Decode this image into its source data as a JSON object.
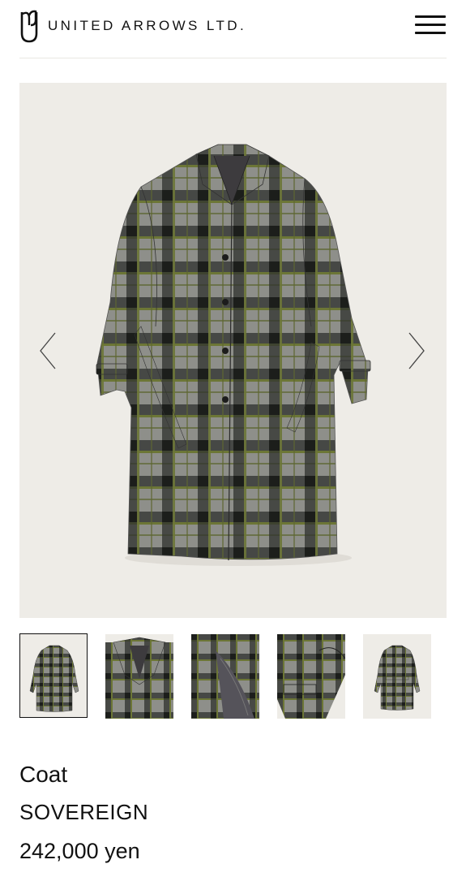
{
  "header": {
    "brand": "UNITED ARROWS LTD.",
    "logo_icon": "ua-monogram-icon",
    "menu_icon": "hamburger-menu-icon"
  },
  "gallery": {
    "main_image": "plaid-coat-front",
    "prev_icon": "chevron-left-icon",
    "next_icon": "chevron-right-icon",
    "thumbnails": [
      {
        "name": "coat-front",
        "selected": true
      },
      {
        "name": "coat-collar-detail",
        "selected": false
      },
      {
        "name": "coat-lining-detail",
        "selected": false
      },
      {
        "name": "coat-cuff-detail",
        "selected": false
      },
      {
        "name": "coat-back",
        "selected": false
      }
    ],
    "colors": {
      "background": "#eeece7",
      "plaid_gray": "#8a8b86",
      "plaid_dark": "#2b2d2a",
      "plaid_green": "#6f7a37"
    }
  },
  "product": {
    "category": "Coat",
    "name": "SOVEREIGN",
    "price": "242,000 yen"
  }
}
